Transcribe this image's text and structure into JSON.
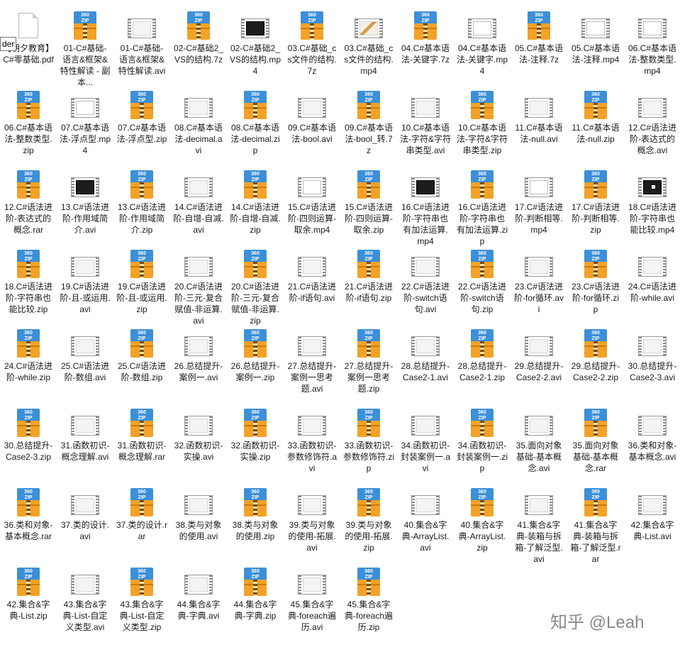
{
  "tooltip": "der",
  "watermark": "知乎 @Leah",
  "files": [
    {
      "label": "【朝夕教育】C#零基础.pdf",
      "type": "pdf"
    },
    {
      "label": "01-C#基础-语言&框架&特性解读 - 副本...",
      "type": "zip"
    },
    {
      "label": "01-C#基础-语言&框架&特性解读.avi",
      "type": "avi"
    },
    {
      "label": "02-C#基础2_VS的结构.7z",
      "type": "zip"
    },
    {
      "label": "02-C#基础2_VS的结构.mp4",
      "type": "mp4d"
    },
    {
      "label": "03.C#基础_cs文件的结构.7z",
      "type": "zip"
    },
    {
      "label": "03.C#基础_cs文件的结构.mp4",
      "type": "mp4i"
    },
    {
      "label": "04.C#基本语法-关键字.7z",
      "type": "zip"
    },
    {
      "label": "04.C#基本语法-关键字.mp4",
      "type": "mp4"
    },
    {
      "label": "05.C#基本语法-注释.7z",
      "type": "zip"
    },
    {
      "label": "05.C#基本语法-注释.mp4",
      "type": "mp4"
    },
    {
      "label": "06.C#基本语法-整数类型.mp4",
      "type": "mp4"
    },
    {
      "label": "06.C#基本语法-整数类型.zip",
      "type": "zip"
    },
    {
      "label": "07.C#基本语法-浮点型.mp4",
      "type": "mp4"
    },
    {
      "label": "07.C#基本语法-浮点型.zip",
      "type": "zip"
    },
    {
      "label": "08.C#基本语法-decimal.avi",
      "type": "avi"
    },
    {
      "label": "08.C#基本语法-decimal.zip",
      "type": "zip"
    },
    {
      "label": "09.C#基本语法-bool.avi",
      "type": "avi"
    },
    {
      "label": "09.C#基本语法-bool_转.7z",
      "type": "zip"
    },
    {
      "label": "10.C#基本语法-字符&字符串类型.avi",
      "type": "avi"
    },
    {
      "label": "10.C#基本语法-字符&字符串类型.zip",
      "type": "zip"
    },
    {
      "label": "11.C#基本语法-null.avi",
      "type": "avi"
    },
    {
      "label": "11.C#基本语法-null.zip",
      "type": "zip"
    },
    {
      "label": "12.C#语法进阶-表达式的概念.avi",
      "type": "avi"
    },
    {
      "label": "12.C#语法进阶-表达式的概念.rar",
      "type": "zip"
    },
    {
      "label": "13.C#语法进阶-作用域简介.avi",
      "type": "mp4d"
    },
    {
      "label": "13.C#语法进阶-作用域简介.zip",
      "type": "zip"
    },
    {
      "label": "14.C#语法进阶-自增-自减.avi",
      "type": "avi"
    },
    {
      "label": "14.C#语法进阶-自增-自减.zip",
      "type": "zip"
    },
    {
      "label": "15.C#语法进阶-四则运算-取余.mp4",
      "type": "mp4"
    },
    {
      "label": "15.C#语法进阶-四则运算-取余.zip",
      "type": "zip"
    },
    {
      "label": "16.C#语法进阶-字符串也有加法运算.mp4",
      "type": "mp4d"
    },
    {
      "label": "16.C#语法进阶-字符串也有加法运算.zip",
      "type": "zip"
    },
    {
      "label": "17.C#语法进阶-判断相等.mp4",
      "type": "mp4"
    },
    {
      "label": "17.C#语法进阶-判断相等.zip",
      "type": "zip"
    },
    {
      "label": "18.C#语法进阶-字符串也能比较.mp4",
      "type": "mp4dot"
    },
    {
      "label": "18.C#语法进阶-字符串也能比较.zip",
      "type": "zip"
    },
    {
      "label": "19.C#语法进阶-且-或运用.avi",
      "type": "avi"
    },
    {
      "label": "19.C#语法进阶-且-或运用.zip",
      "type": "zip"
    },
    {
      "label": "20.C#语法进阶-三元-复合赋值-非运算.avi",
      "type": "avi"
    },
    {
      "label": "20.C#语法进阶-三元-复合赋值-非运算.zip",
      "type": "zip"
    },
    {
      "label": "21.C#语法进阶-if语句.avi",
      "type": "avi"
    },
    {
      "label": "21.C#语法进阶-if语句.zip",
      "type": "zip"
    },
    {
      "label": "22.C#语法进阶-switch语句.avi",
      "type": "avi"
    },
    {
      "label": "22.C#语法进阶-switch语句.zip",
      "type": "zip"
    },
    {
      "label": "23.C#语法进阶-for循环.avi",
      "type": "avi"
    },
    {
      "label": "23.C#语法进阶-for循环.zip",
      "type": "zip"
    },
    {
      "label": "24.C#语法进阶-while.avi",
      "type": "avi"
    },
    {
      "label": "24.C#语法进阶-while.zip",
      "type": "zip"
    },
    {
      "label": "25.C#语法进阶-数组.avi",
      "type": "avi"
    },
    {
      "label": "25.C#语法进阶-数组.zip",
      "type": "zip"
    },
    {
      "label": "26.总结提升-案例一.avi",
      "type": "avi"
    },
    {
      "label": "26.总结提升-案例一.zip",
      "type": "zip"
    },
    {
      "label": "27.总结提升-案例一思考题.avi",
      "type": "avi"
    },
    {
      "label": "27.总结提升-案例一思考题.zip",
      "type": "zip"
    },
    {
      "label": "28.总结提升-Case2-1.avi",
      "type": "avi"
    },
    {
      "label": "28.总结提升-Case2-1.zip",
      "type": "zip"
    },
    {
      "label": "29.总结提升-Case2-2.avi",
      "type": "avi"
    },
    {
      "label": "29.总结提升-Case2-2.zip",
      "type": "zip"
    },
    {
      "label": "30.总结提升-Case2-3.avi",
      "type": "avi"
    },
    {
      "label": "30.总结提升-Case2-3.zip",
      "type": "zip"
    },
    {
      "label": "31.函数初识-概念理解.avi",
      "type": "avi"
    },
    {
      "label": "31.函数初识-概念理解.rar",
      "type": "zip"
    },
    {
      "label": "32.函数初识-实操.avi",
      "type": "avi"
    },
    {
      "label": "32.函数初识-实操.zip",
      "type": "zip"
    },
    {
      "label": "33.函数初识-参数修饰符.avi",
      "type": "avi"
    },
    {
      "label": "33.函数初识-参数修饰符.zip",
      "type": "zip"
    },
    {
      "label": "34.函数初识-封装案例一.avi",
      "type": "avi"
    },
    {
      "label": "34.函数初识-封装案例一.zip",
      "type": "zip"
    },
    {
      "label": "35.面向对象基础-基本概念.avi",
      "type": "avi"
    },
    {
      "label": "35.面向对象基础-基本概念.rar",
      "type": "zip"
    },
    {
      "label": "36.类和对象-基本概念.avi",
      "type": "avi"
    },
    {
      "label": "36.类和对象-基本概念.rar",
      "type": "zip"
    },
    {
      "label": "37.类的设计.avi",
      "type": "avi"
    },
    {
      "label": "37.类的设计.rar",
      "type": "zip"
    },
    {
      "label": "38.类与对象的使用.avi",
      "type": "avi"
    },
    {
      "label": "38.类与对象的使用.zip",
      "type": "zip"
    },
    {
      "label": "39.类与对象的使用-拓展.avi",
      "type": "avi"
    },
    {
      "label": "39.类与对象的使用-拓展.zip",
      "type": "zip"
    },
    {
      "label": "40.集合&字典-ArrayList.avi",
      "type": "avi"
    },
    {
      "label": "40.集合&字典-ArrayList.zip",
      "type": "zip"
    },
    {
      "label": "41.集合&字典-装箱与拆箱-了解泛型.avi",
      "type": "avi"
    },
    {
      "label": "41.集合&字典-装箱与拆箱-了解泛型.rar",
      "type": "zip"
    },
    {
      "label": "42.集合&字典-List.avi",
      "type": "avi"
    },
    {
      "label": "42.集合&字典-List.zip",
      "type": "zip"
    },
    {
      "label": "43.集合&字典-List-自定义类型.avi",
      "type": "avi"
    },
    {
      "label": "43.集合&字典-List-自定义类型.zip",
      "type": "zip"
    },
    {
      "label": "44.集合&字典-字典.avi",
      "type": "avi"
    },
    {
      "label": "44.集合&字典-字典.zip",
      "type": "zip"
    },
    {
      "label": "45.集合&字典-foreach遍历.avi",
      "type": "avi"
    },
    {
      "label": "45.集合&字典-foreach遍历.zip",
      "type": "zip"
    }
  ]
}
